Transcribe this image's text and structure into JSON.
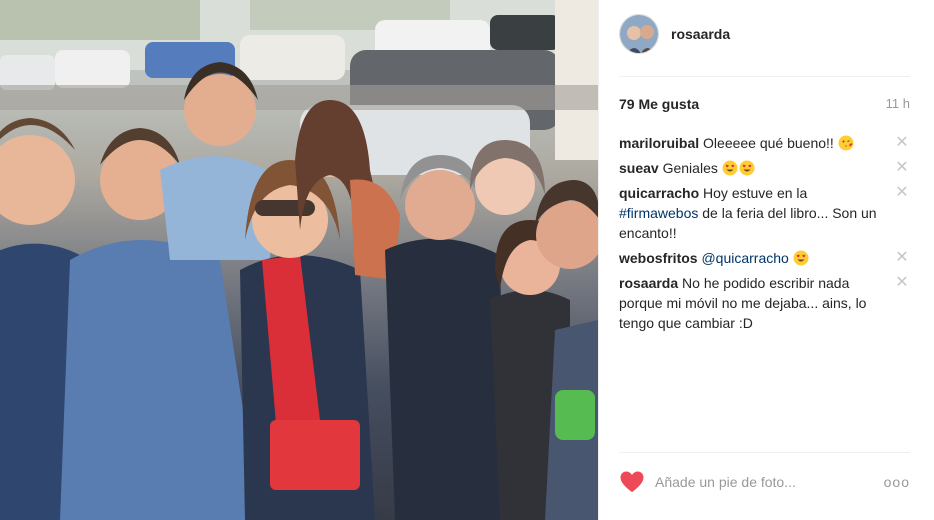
{
  "post": {
    "username": "rosaarda",
    "likes": "79 Me gusta",
    "time": "11 h",
    "photo_alt": "Group selfie"
  },
  "comments": [
    {
      "user": "mariloruibal",
      "parts": [
        {
          "t": "text",
          "v": "Oleeeee qué bueno!!"
        }
      ],
      "emoji": "kiss-emoji"
    },
    {
      "user": "sueav",
      "parts": [
        {
          "t": "text",
          "v": "Geniales"
        }
      ],
      "emoji": "heart-eyes-emoji-x2"
    },
    {
      "user": "quicarracho",
      "parts": [
        {
          "t": "text",
          "v": "Hoy estuve en la "
        },
        {
          "t": "tag",
          "v": "#firmawebos"
        },
        {
          "t": "text",
          "v": " de la feria del libro... Son un encanto!!"
        }
      ],
      "emoji": ""
    },
    {
      "user": "webosfritos",
      "parts": [
        {
          "t": "tag",
          "v": "@quicarracho"
        }
      ],
      "emoji": "heart-eyes-emoji"
    },
    {
      "user": "rosaarda",
      "parts": [
        {
          "t": "text",
          "v": "No he podido escribir nada porque mi móvil no me dejaba... ains, lo tengo que cambiar :D"
        }
      ],
      "emoji": ""
    }
  ],
  "footer": {
    "caption_placeholder": "Añade un pie de foto...",
    "more_label": "ooo"
  },
  "colors": {
    "like_heart": "#ed4956",
    "link": "#003569",
    "muted": "#999999",
    "delete_x": "#c7c7c7"
  },
  "icons": {
    "like": "heart-icon",
    "delete": "close-icon",
    "more": "more-options-icon"
  }
}
